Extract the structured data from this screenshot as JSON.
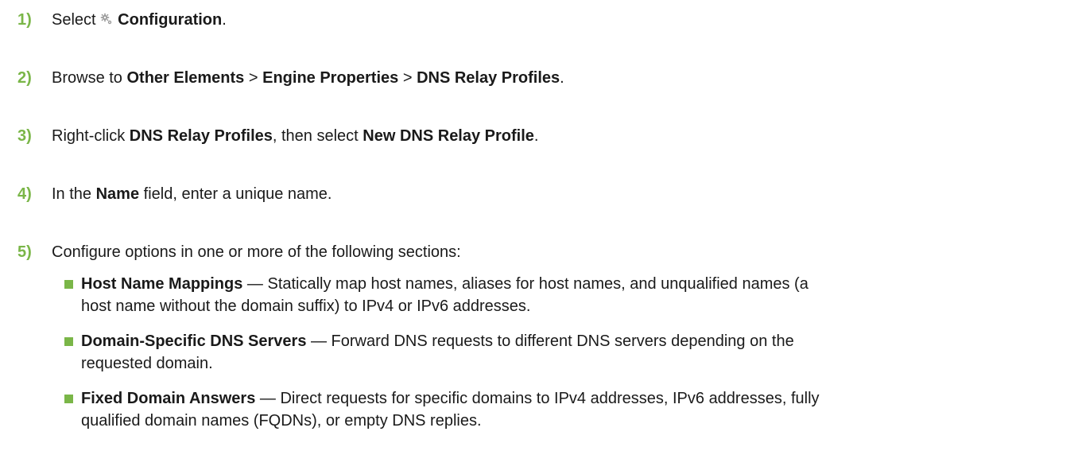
{
  "steps": [
    {
      "num": "1)",
      "pre": "Select ",
      "icon": "gear-icon",
      "bold": "Configuration",
      "post": "."
    },
    {
      "num": "2)",
      "pre": "Browse to ",
      "b1": "Other Elements",
      "sep1": " > ",
      "b2": "Engine Properties",
      "sep2": " > ",
      "b3": "DNS Relay Profiles",
      "post": "."
    },
    {
      "num": "3)",
      "pre": "Right-click ",
      "b1": "DNS Relay Profiles",
      "mid": ", then select ",
      "b2": "New DNS Relay Profile",
      "post": "."
    },
    {
      "num": "4)",
      "pre": "In the ",
      "bold": "Name",
      "post": " field, enter a unique name."
    },
    {
      "num": "5)",
      "text": "Configure options in one or more of the following sections:"
    }
  ],
  "bullets": [
    {
      "term": "Host Name Mappings",
      "line1": " — Statically map host names, aliases for host names, and unqualified names (a",
      "line2": "host name without the domain suffix) to IPv4 or IPv6 addresses."
    },
    {
      "term": "Domain-Specific DNS Servers",
      "line1": " — Forward DNS requests to different DNS servers depending on the",
      "line2": "requested domain."
    },
    {
      "term": "Fixed Domain Answers",
      "line1": " — Direct requests for specific domains to IPv4 addresses, IPv6 addresses, fully",
      "line2": "qualified domain names (FQDNs), or empty DNS replies."
    }
  ],
  "colors": {
    "accent": "#7ab648",
    "text": "#1a1a1a"
  }
}
